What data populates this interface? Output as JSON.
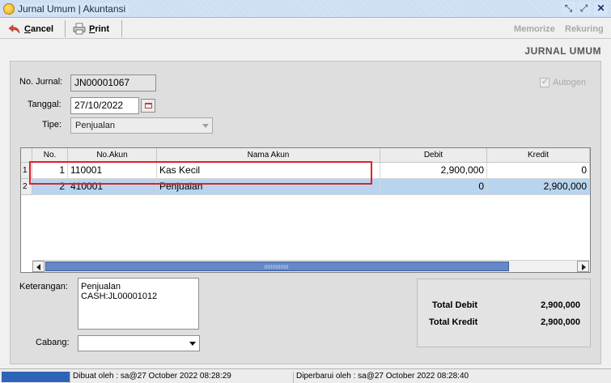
{
  "window": {
    "title": "Jurnal Umum | Akuntansi",
    "controls": [
      "restore-icon",
      "maximize-icon",
      "close-icon"
    ]
  },
  "toolbar": {
    "cancel_label": "Cancel",
    "print_label": "Print",
    "memorize_label": "Memorize",
    "rekuring_label": "Rekuring"
  },
  "header": {
    "title": "JURNAL UMUM"
  },
  "form": {
    "no_jurnal_label": "No. Jurnal:",
    "no_jurnal_value": "JN00001067",
    "tanggal_label": "Tanggal:",
    "tanggal_value": "27/10/2022",
    "tipe_label": "Tipe:",
    "tipe_value": "Penjualan",
    "autogen_label": "Autogen",
    "autogen_checked": true
  },
  "grid": {
    "columns": [
      "No.",
      "No.Akun",
      "Nama Akun",
      "Debit",
      "Kredit"
    ],
    "rows": [
      {
        "row_header": "1",
        "no": "1",
        "akun": "110001",
        "nama": "Kas Kecil",
        "debit": "2,900,000",
        "kredit": "0"
      },
      {
        "row_header": "2",
        "no": "2",
        "akun": "410001",
        "nama": "Penjualan",
        "debit": "0",
        "kredit": "2,900,000"
      }
    ]
  },
  "footer": {
    "keterangan_label": "Keterangan:",
    "keterangan_value": "Penjualan CASH:JL00001012",
    "cabang_label": "Cabang:",
    "cabang_value": "",
    "total_debit_label": "Total Debit",
    "total_debit_value": "2,900,000",
    "total_kredit_label": "Total Kredit",
    "total_kredit_value": "2,900,000"
  },
  "status": {
    "created": "Dibuat oleh : sa@27 October 2022  08:28:29",
    "updated": "Diperbarui oleh : sa@27 October 2022  08:28:40"
  },
  "colors": {
    "selected_row": "#b8d4ee",
    "highlight_box": "#e0202a",
    "status_block": "#2f63b8"
  }
}
